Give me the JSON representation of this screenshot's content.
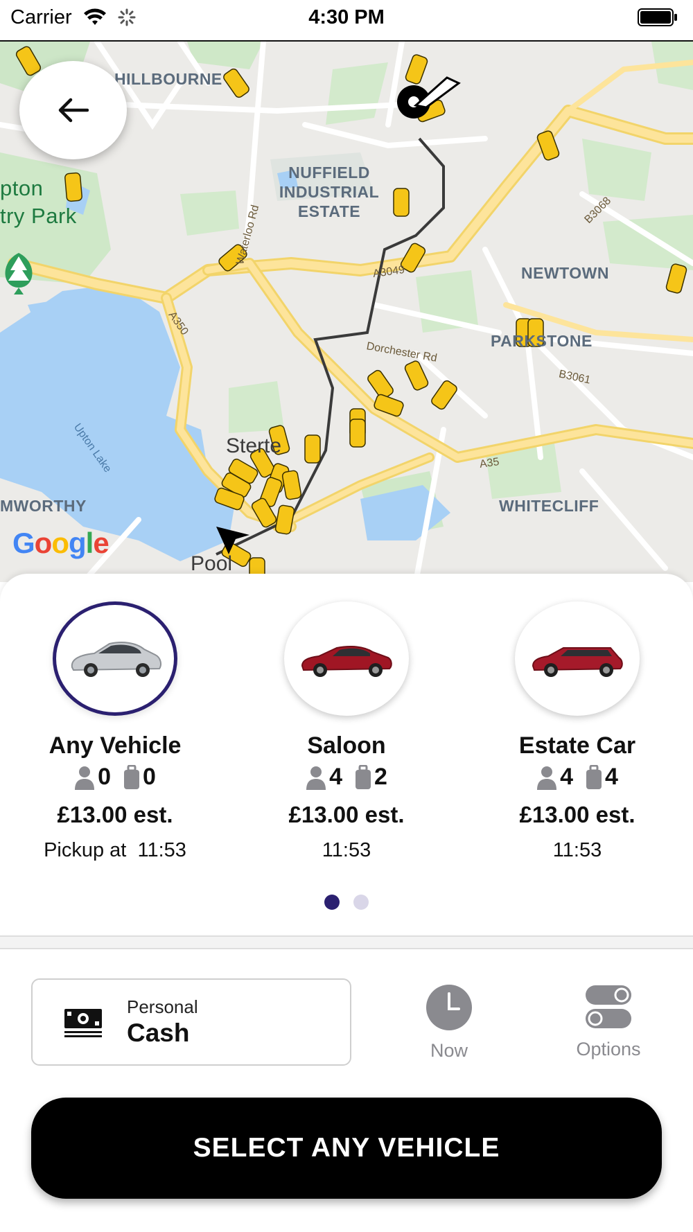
{
  "status_bar": {
    "carrier": "Carrier",
    "time": "4:30 PM"
  },
  "map": {
    "labels": {
      "hillbourne": "HILLBOURNE",
      "nuffield": "NUFFIELD\nINDUSTRIAL\nESTATE",
      "newtown": "NEWTOWN",
      "parkstone": "PARKSTONE",
      "sterte": "Sterte",
      "hamworthy": "MWORTHY",
      "whitecliff": "WHITECLIFF",
      "park": "pton\ntry Park",
      "poole": "Pool"
    },
    "roads": {
      "a3049": "A3049",
      "a350": "A350",
      "b3068": "B3068",
      "b3061": "B3061",
      "a35": "A35",
      "waterloo": "Waterloo Rd",
      "dorchester": "Dorchester Rd",
      "upton_lake": "Upton Lake"
    },
    "logo": [
      "G",
      "o",
      "o",
      "g",
      "l",
      "e"
    ]
  },
  "vehicles": [
    {
      "name": "Any Vehicle",
      "passengers": "0",
      "luggage": "0",
      "price": "£13.00 est.",
      "pickup": "Pickup at  11:53",
      "selected": true
    },
    {
      "name": "Saloon",
      "passengers": "4",
      "luggage": "2",
      "price": "£13.00 est.",
      "pickup": "11:53",
      "selected": false
    },
    {
      "name": "Estate Car",
      "passengers": "4",
      "luggage": "4",
      "price": "£13.00 est.",
      "pickup": "11:53",
      "selected": false
    }
  ],
  "pager": {
    "count": 2,
    "active": 0
  },
  "payment": {
    "type": "Personal",
    "method": "Cash"
  },
  "controls": {
    "when_label": "Now",
    "options_label": "Options"
  },
  "action": {
    "select_label": "SELECT ANY VEHICLE"
  },
  "colors": {
    "accent": "#2b2070",
    "taxi": "#f5c518",
    "primary_button": "#000000"
  },
  "icons": [
    "back-arrow-icon",
    "wifi-icon",
    "loading-icon",
    "battery-icon",
    "person-icon",
    "luggage-icon",
    "cash-icon",
    "clock-icon",
    "toggle-options-icon",
    "tree-pin-icon",
    "destination-pin-icon",
    "taxi-icon"
  ]
}
